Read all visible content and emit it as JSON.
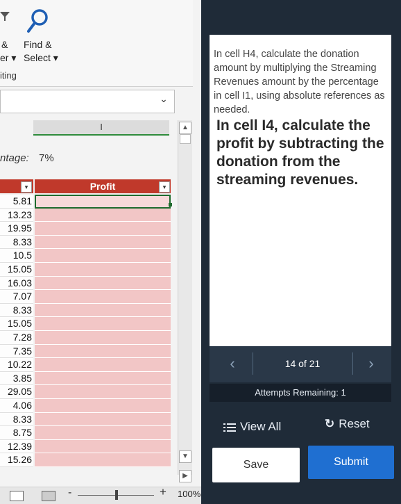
{
  "ribbon": {
    "find_select_line1_left": "&",
    "find_label": "Find &",
    "line2_left": "er ▾",
    "select_label": "Select ▾",
    "editing_label": "iting"
  },
  "namebox": {
    "chevron": "⌄"
  },
  "column_header": {
    "label": "I"
  },
  "percentage": {
    "label": "ntage:",
    "value": "7%"
  },
  "table": {
    "profit_header": "Profit",
    "dropdown_glyph": "▾",
    "left_values": [
      "5.81",
      "13.23",
      "19.95",
      "8.33",
      "10.5",
      "15.05",
      "16.03",
      "7.07",
      "8.33",
      "15.05",
      "7.28",
      "7.35",
      "10.22",
      "3.85",
      "29.05",
      "4.06",
      "8.33",
      "8.75",
      "12.39",
      "15.26"
    ]
  },
  "statusbar": {
    "minus": "-",
    "plus": "+",
    "zoom": "100%"
  },
  "instructions": {
    "previous": "In cell H4, calculate the donation amount by multiplying the Streaming Revenues amount by the percentage in cell I1, using absolute references as needed.",
    "current": "In cell I4, calculate the profit by subtracting the donation from the streaming revenues."
  },
  "nav": {
    "prev": "‹",
    "next": "›",
    "progress": "14 of 21"
  },
  "attempts": "Attempts Remaining: 1",
  "actions": {
    "view_all": "View All",
    "reset": "Reset",
    "save": "Save",
    "submit": "Submit"
  },
  "colors": {
    "header_red": "#c0392b",
    "row_pink": "#f2c6c6",
    "selection_green": "#1f6b2e",
    "submit_blue": "#1f6fd1",
    "panel_dark": "#1f2b38"
  }
}
